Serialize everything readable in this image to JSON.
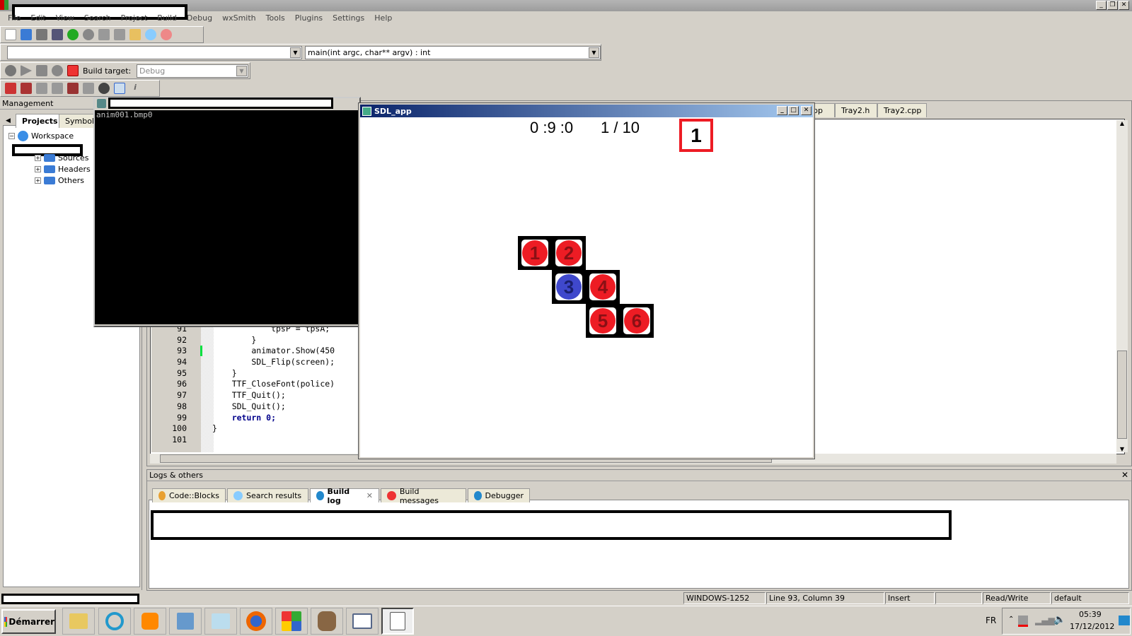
{
  "menu": [
    "File",
    "Edit",
    "View",
    "Search",
    "Project",
    "Build",
    "Debug",
    "wxSmith",
    "Tools",
    "Plugins",
    "Settings",
    "Help"
  ],
  "toolbar": {
    "function_combo": "main(int argc, char** argv) : int",
    "build_target_label": "Build target:",
    "build_target_value": "Debug"
  },
  "management": {
    "title": "Management",
    "tabs": [
      "Projects",
      "Symbols"
    ],
    "tree": {
      "root": "Workspace",
      "folders": [
        "Sources",
        "Headers",
        "Others"
      ]
    }
  },
  "editor": {
    "tabs": [
      "pp",
      "Tray2.h",
      "Tray2.cpp"
    ],
    "lines": [
      {
        "n": "91",
        "t": "            tpsP = tpsA;"
      },
      {
        "n": "92",
        "t": "        }"
      },
      {
        "n": "93",
        "t": "        animator.Show(450"
      },
      {
        "n": "94",
        "t": "        SDL_Flip(screen);"
      },
      {
        "n": "95",
        "t": "    }"
      },
      {
        "n": "96",
        "t": "    TTF_CloseFont(police)"
      },
      {
        "n": "97",
        "t": "    TTF_Quit();"
      },
      {
        "n": "98",
        "t": "    SDL_Quit();"
      },
      {
        "n": "99",
        "t": "    return 0;"
      },
      {
        "n": "100",
        "t": "}"
      },
      {
        "n": "101",
        "t": ""
      }
    ]
  },
  "console": {
    "output": "anim001.bmp0"
  },
  "sdl_app": {
    "title": "SDL_app",
    "timer": "0 :9 :0",
    "progress": "1 / 10",
    "level": "1",
    "tiles": [
      {
        "label": "1",
        "row": 0,
        "col": 0,
        "color": "#ed1c24"
      },
      {
        "label": "2",
        "row": 0,
        "col": 1,
        "color": "#ed1c24"
      },
      {
        "label": "3",
        "row": 1,
        "col": 1,
        "color": "#3f48cc"
      },
      {
        "label": "4",
        "row": 1,
        "col": 2,
        "color": "#ed1c24"
      },
      {
        "label": "5",
        "row": 2,
        "col": 2,
        "color": "#ed1c24"
      },
      {
        "label": "6",
        "row": 2,
        "col": 3,
        "color": "#ed1c24"
      }
    ]
  },
  "logs": {
    "title": "Logs & others",
    "tabs": [
      "Code::Blocks",
      "Search results",
      "Build log",
      "Build messages",
      "Debugger"
    ],
    "active": "Build log"
  },
  "status": {
    "encoding": "WINDOWS-1252",
    "position": "Line 93, Column 39",
    "mode": "Insert",
    "access": "Read/Write",
    "profile": "default"
  },
  "taskbar": {
    "start": "Démarrer",
    "lang": "FR",
    "time": "05:39",
    "date": "17/12/2012"
  }
}
